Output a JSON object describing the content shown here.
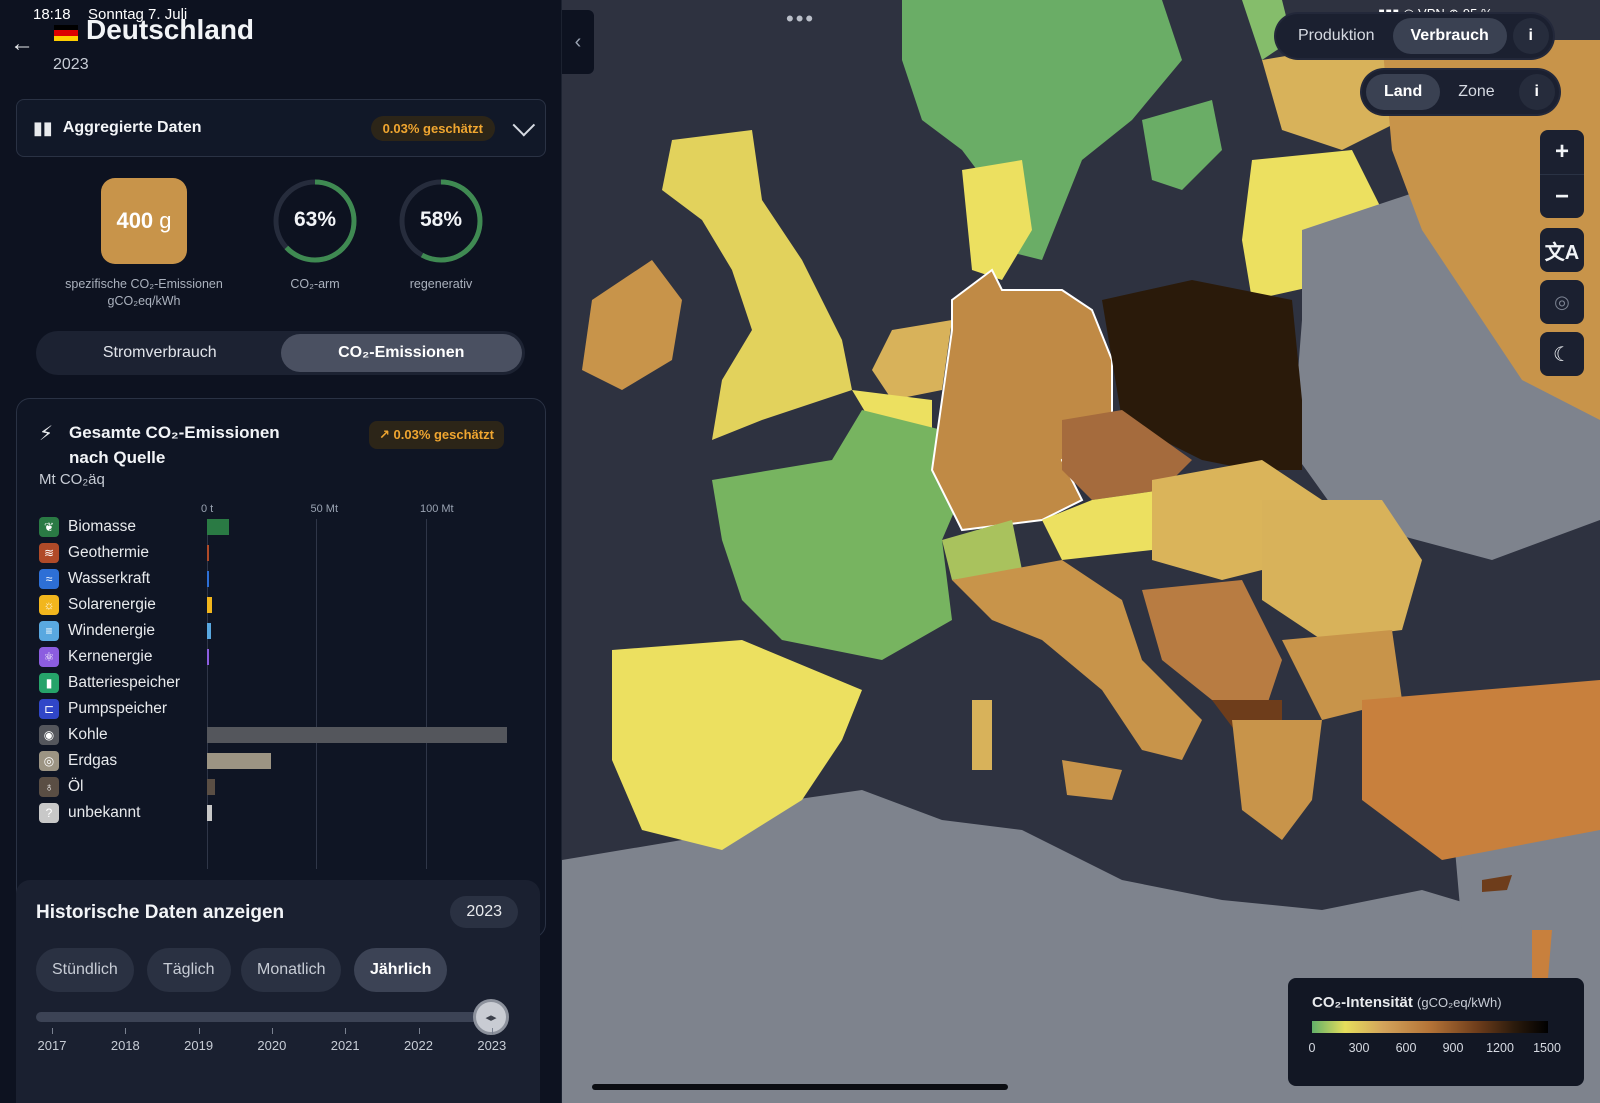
{
  "status": {
    "time": "18:18",
    "date": "Sonntag 7. Juli",
    "battery": "95 %",
    "vpn": "VPN"
  },
  "header": {
    "country": "Deutschland",
    "year": "2023"
  },
  "aggregate": {
    "label": "Aggregierte Daten",
    "badge": "0.03% geschätzt"
  },
  "kpis": {
    "intensity_value": "400",
    "intensity_unit": "g",
    "intensity_caption_1": "spezifische CO₂-Emissionen",
    "intensity_caption_2": "gCO₂eq/kWh",
    "low_carbon_value": "63%",
    "low_carbon_pct": 0.63,
    "low_carbon_label": "CO₂-arm",
    "renewable_value": "58%",
    "renewable_pct": 0.58,
    "renewable_label": "regenerativ"
  },
  "mode_toggle": {
    "option1": "Stromverbrauch",
    "option2": "CO₂-Emissionen"
  },
  "emissions_card": {
    "title": "Gesamte CO₂-Emissionen nach Quelle",
    "badge": "0.03% geschätzt",
    "unit": "Mt CO₂äq",
    "ticks": [
      "0 t",
      "50 Mt",
      "100 Mt"
    ]
  },
  "chart_data": {
    "type": "bar",
    "orientation": "horizontal",
    "title": "Gesamte CO₂-Emissionen nach Quelle",
    "xlabel": "Mt CO₂äq",
    "xlim": [
      0,
      137
    ],
    "categories": [
      "Biomasse",
      "Geothermie",
      "Wasserkraft",
      "Solarenergie",
      "Windenergie",
      "Kernenergie",
      "Batteriespeicher",
      "Pumpspeicher",
      "Kohle",
      "Erdgas",
      "Öl",
      "unbekannt"
    ],
    "values": [
      10,
      0.2,
      0.5,
      2.2,
      2.0,
      0.5,
      0,
      0,
      137,
      29,
      3.5,
      2.2
    ],
    "colors": [
      "#2a7a44",
      "#b04a28",
      "#2d6fd6",
      "#f2b61d",
      "#59a8e0",
      "#8c5de0",
      "#26a36a",
      "#3046c8",
      "#54565c",
      "#9c9483",
      "#5a4e44",
      "#c8c8c8"
    ],
    "grid": true
  },
  "source_icons": [
    "sprout-icon",
    "geothermal-icon",
    "water-icon",
    "sun-icon",
    "wind-icon",
    "atom-icon",
    "battery-icon",
    "pump-storage-icon",
    "coal-icon",
    "gas-icon",
    "oil-icon",
    "unknown-icon"
  ],
  "history": {
    "title": "Historische Daten anzeigen",
    "year": "2023",
    "chips": [
      "Stündlich",
      "Täglich",
      "Monatlich",
      "Jährlich"
    ],
    "years": [
      "2017",
      "2018",
      "2019",
      "2020",
      "2021",
      "2022",
      "2023"
    ]
  },
  "map_controls": {
    "production": "Produktion",
    "consumption": "Verbrauch",
    "info": "i",
    "country": "Land",
    "zone": "Zone"
  },
  "legend": {
    "title": "CO₂-Intensität",
    "unit": "(gCO₂eq/kWh)",
    "scale": [
      "0",
      "300",
      "600",
      "900",
      "1200",
      "1500"
    ]
  }
}
